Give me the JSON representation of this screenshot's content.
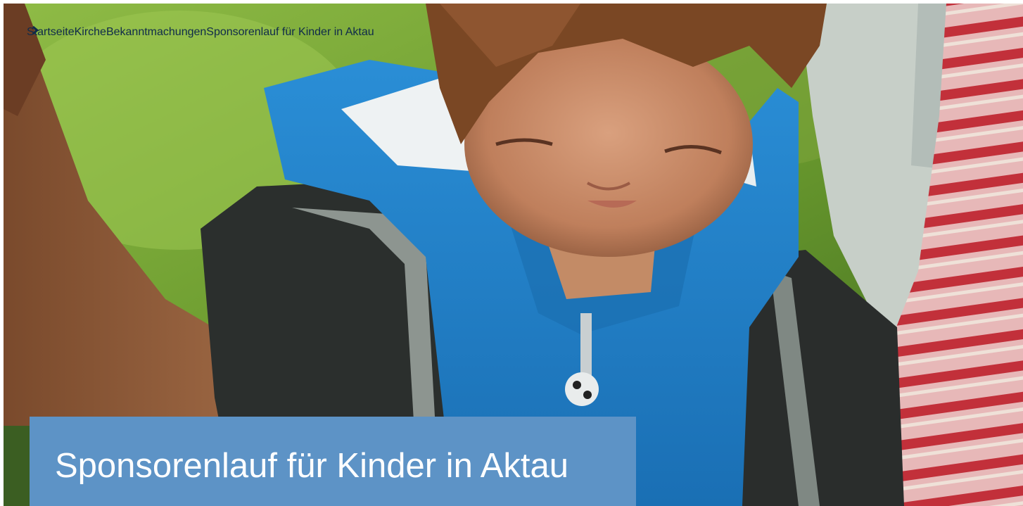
{
  "breadcrumb": {
    "items": [
      {
        "label": "Startseite"
      },
      {
        "label": "Kirche"
      },
      {
        "label": "Bekanntmachungen"
      },
      {
        "label": "Sponsorenlauf für Kinder in Aktau"
      }
    ],
    "separator_icon": "chevron-right-icon"
  },
  "hero": {
    "image_icon": "photo-boy-blue-hoodie"
  },
  "page_title": "Sponsorenlauf für Kinder in Aktau",
  "colors": {
    "title_box": "#5d93c6",
    "title_text": "#ffffff",
    "breadcrumb_text": "#0f2a4a"
  }
}
